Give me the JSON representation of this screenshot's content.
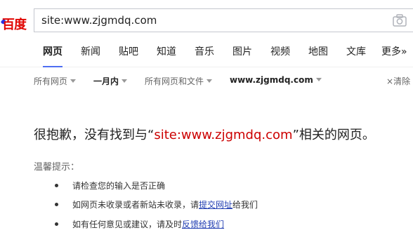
{
  "header": {
    "logo_text": "百度",
    "search_value": "site:www.zjgmdq.com",
    "camera_icon": "camera-icon"
  },
  "tabs": [
    {
      "label": "网页",
      "active": true
    },
    {
      "label": "新闻"
    },
    {
      "label": "贴吧"
    },
    {
      "label": "知道"
    },
    {
      "label": "音乐"
    },
    {
      "label": "图片"
    },
    {
      "label": "视频"
    },
    {
      "label": "地图"
    },
    {
      "label": "文库"
    },
    {
      "label": "更多»"
    }
  ],
  "filters": {
    "all_pages": "所有网页",
    "time": "一月内",
    "file_type": "所有网页和文件",
    "site": "www.zjgmdq.com",
    "clear": "清除"
  },
  "result": {
    "prefix": "很抱歉，没有找到与",
    "open_quote": "“",
    "query": "site:www.zjgmdq.com",
    "close_quote": "”",
    "suffix": "相关的网页。"
  },
  "tips": {
    "title": "温馨提示：",
    "item1": "请检查您的输入是否正确",
    "item2_prefix": "如网页未收录或者新站未收录，请",
    "item2_link": "提交网址",
    "item2_suffix": "给我们",
    "item3_prefix": "如有任何意见或建议，请及时",
    "item3_link": "反馈给我们"
  }
}
